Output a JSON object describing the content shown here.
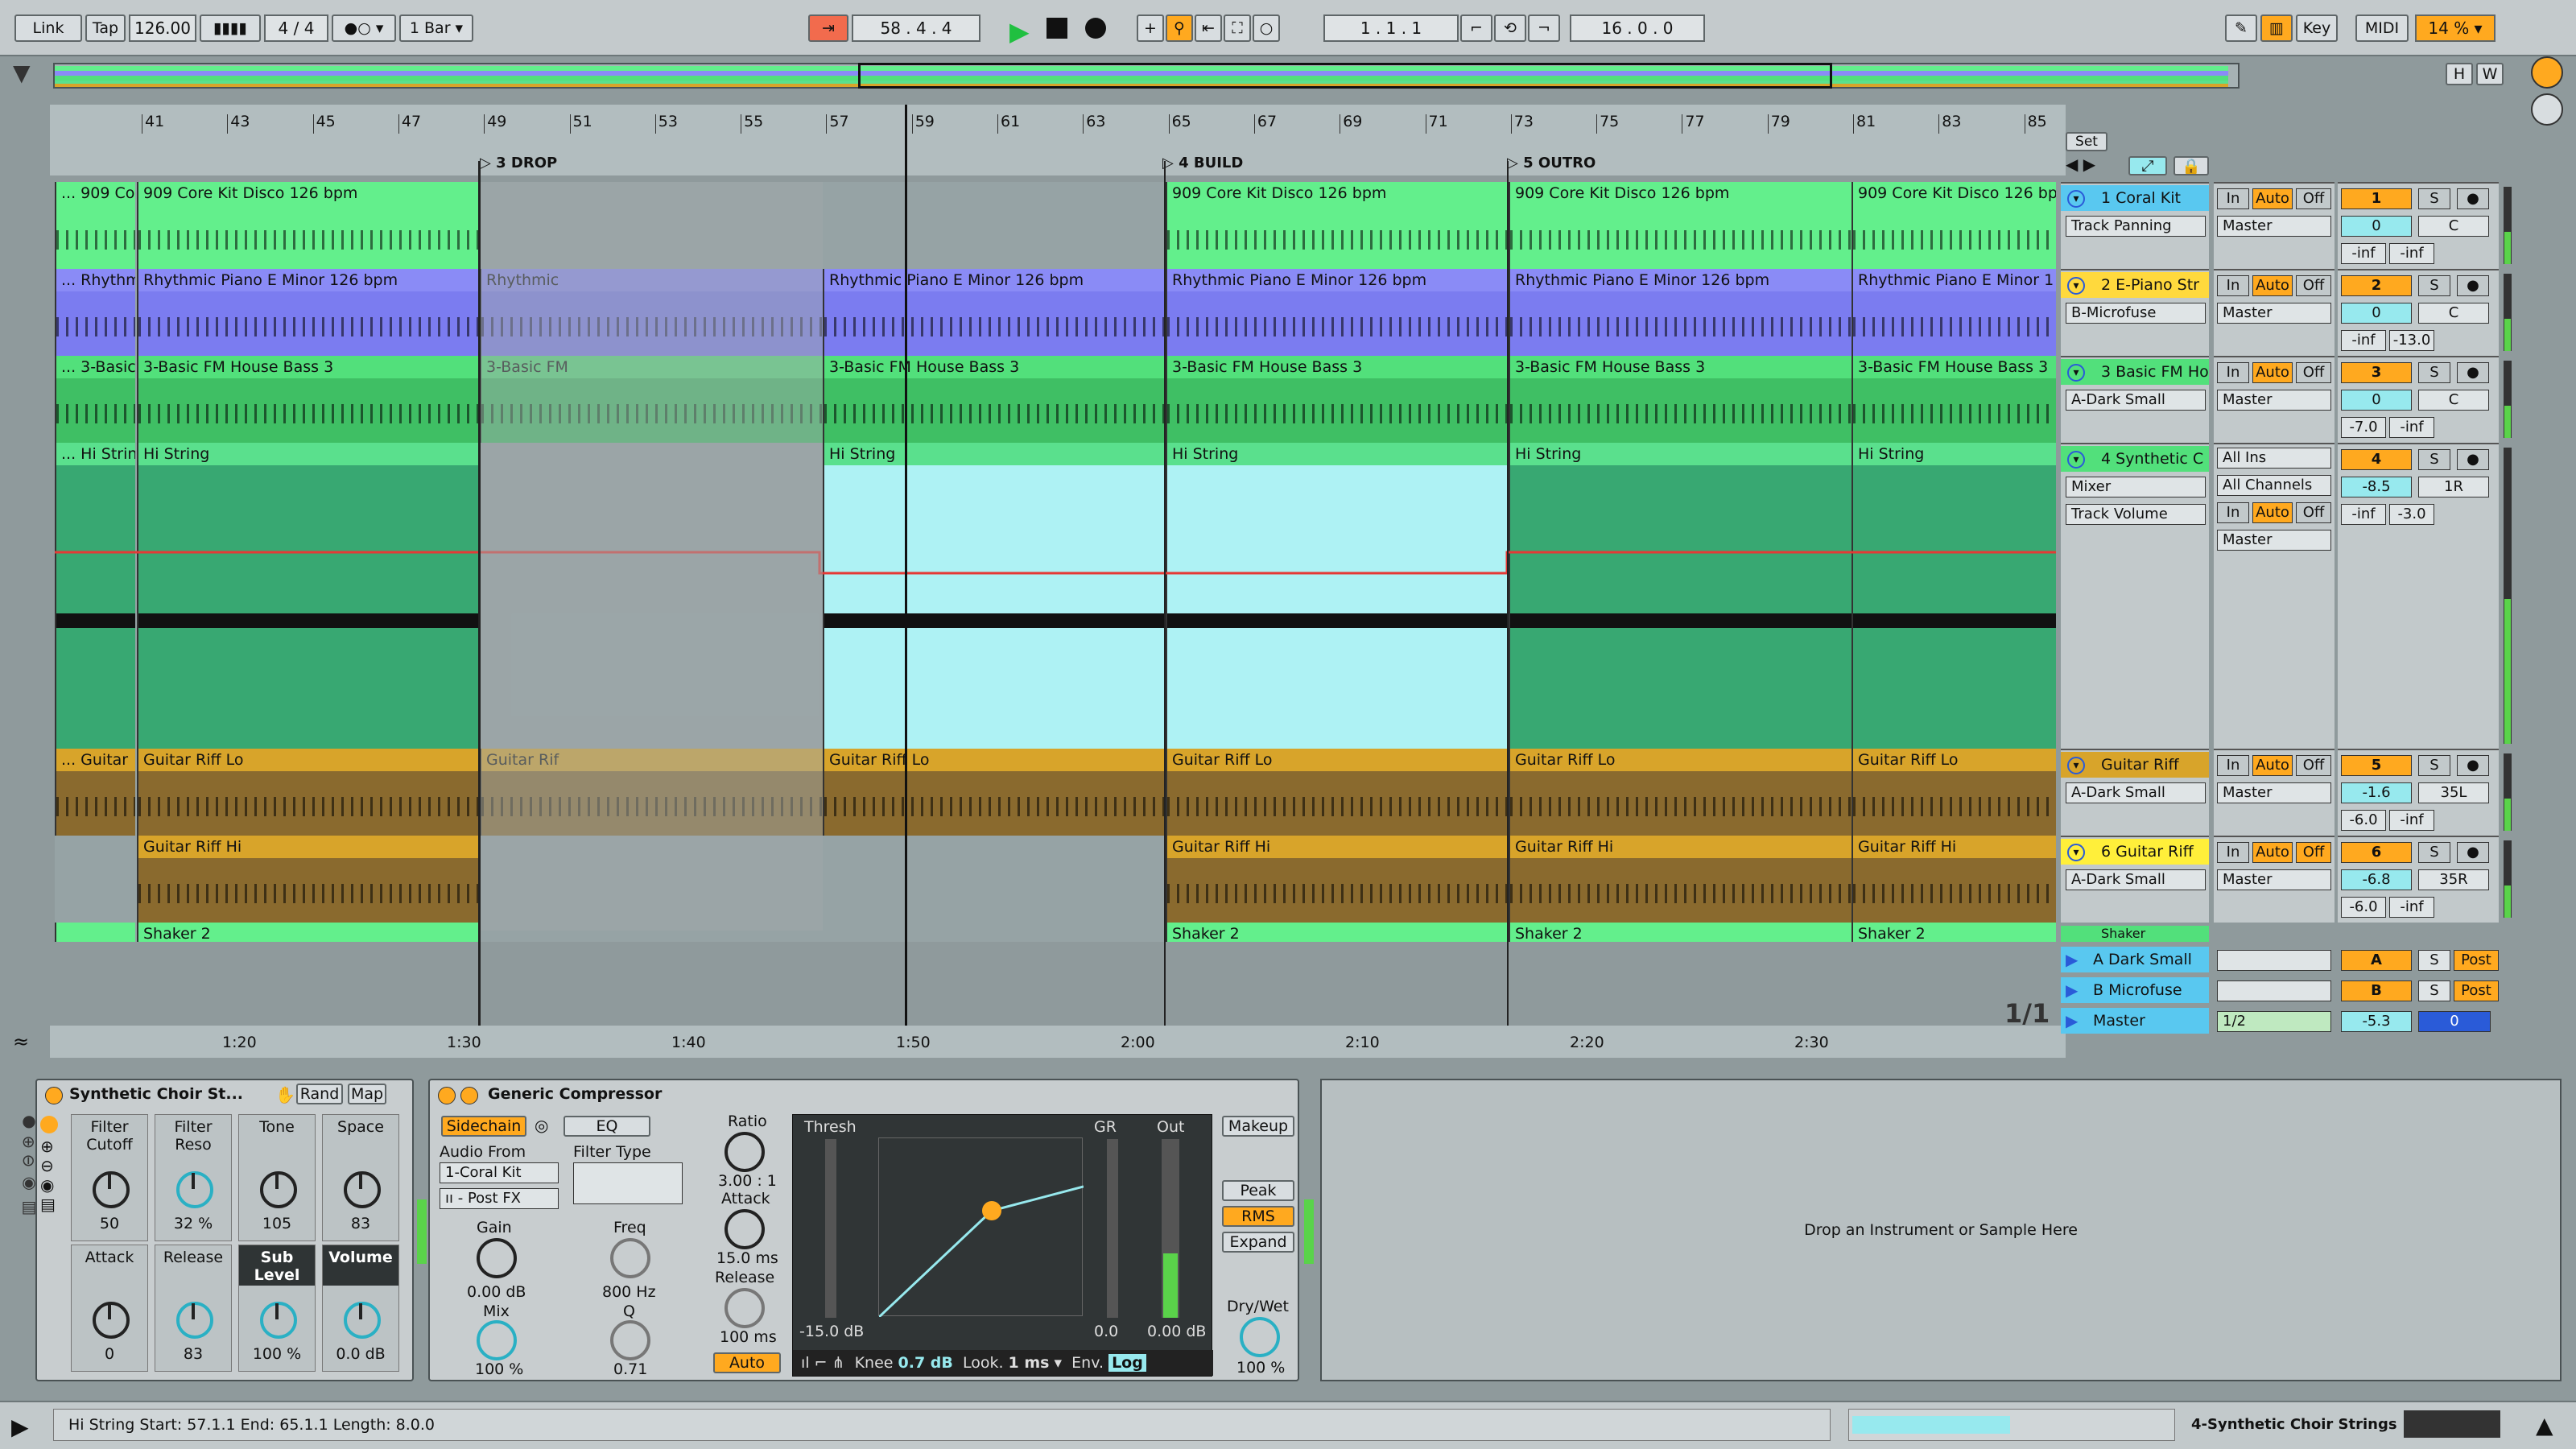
{
  "transport": {
    "link": "Link",
    "tap": "Tap",
    "tempo": "126.00",
    "time_sig": "4 / 4",
    "quantize": "1 Bar",
    "position": "58 .  4 .  4",
    "loop_start": "1 .  1 .  1",
    "loop_length": "16 .  0 .  0",
    "key": "Key",
    "midi": "MIDI",
    "cpu": "14 %",
    "h": "H",
    "w": "W"
  },
  "ruler": {
    "bars": [
      "41",
      "43",
      "45",
      "47",
      "49",
      "51",
      "53",
      "55",
      "57",
      "59",
      "61",
      "63",
      "65",
      "67",
      "69",
      "71",
      "73",
      "75",
      "77",
      "79",
      "81",
      "83",
      "85"
    ],
    "locators": [
      "3 DROP",
      "4 BUILD",
      "5 OUTRO"
    ],
    "set": "Set",
    "times": [
      "1:20",
      "1:30",
      "1:40",
      "1:50",
      "2:00",
      "2:10",
      "2:20",
      "2:30"
    ],
    "page": "1/1"
  },
  "tracks": [
    {
      "name": "1 Coral Kit",
      "clip_a": "... 909 Co",
      "clip": "909 Core Kit Disco 126 bpm",
      "dev": "Track Panning",
      "route": "Master",
      "num": "1",
      "vol": "0",
      "pan": "C",
      "m1": "-inf",
      "m2": "-inf",
      "in": "In",
      "auto": "Auto",
      "off": "Off",
      "s": "S"
    },
    {
      "name": "2 E-Piano Str",
      "clip_a": "... Rhythm",
      "clip": "Rhythmic Piano E Minor 126 bpm",
      "clip_b": "Rhythmic",
      "clip_c": "Rhythmic Piano E Minor 1",
      "dev": "B-Microfuse",
      "route": "Master",
      "num": "2",
      "vol": "0",
      "pan": "C",
      "m1": "-inf",
      "m2": "-13.0",
      "in": "In",
      "auto": "Auto",
      "off": "Off",
      "s": "S"
    },
    {
      "name": "3 Basic FM Ho",
      "clip_a": "... 3-Basic",
      "clip": "3-Basic FM House Bass 3",
      "clip_b": "3-Basic FM",
      "dev": "A-Dark Small",
      "route": "Master",
      "num": "3",
      "vol": "0",
      "pan": "C",
      "m1": "-7.0",
      "m2": "-inf",
      "in": "In",
      "auto": "Auto",
      "off": "Off",
      "s": "S"
    },
    {
      "name": "4 Synthetic C",
      "clip_a": "... Hi Strin",
      "clip": "Hi String",
      "dev": "Mixer",
      "dev2": "Track Volume",
      "route_in": "All Ins",
      "chan": "All Channels",
      "route": "Master",
      "num": "4",
      "vol": "-8.5",
      "pan": "1R",
      "m1": "-inf",
      "m2": "-3.0",
      "in": "In",
      "auto": "Auto",
      "off": "Off",
      "s": "S"
    },
    {
      "name": "Guitar Riff",
      "clip_a": "... Guitar",
      "clip": "Guitar Riff Lo",
      "clip_b": "Guitar Rif",
      "dev": "A-Dark Small",
      "route": "Master",
      "num": "5",
      "vol": "-1.6",
      "pan": "35L",
      "m1": "-6.0",
      "m2": "-inf",
      "in": "In",
      "auto": "Auto",
      "off": "Off",
      "s": "S"
    },
    {
      "name": "6 Guitar Riff",
      "clip": "Guitar Riff Hi",
      "dev": "A-Dark Small",
      "route": "Master",
      "num": "6",
      "vol": "-6.8",
      "pan": "35R",
      "m1": "-6.0",
      "m2": "-inf",
      "in": "In",
      "auto": "Auto",
      "off": "Off",
      "s": "S"
    },
    {
      "name": "Shaker",
      "clip": "Shaker 2"
    }
  ],
  "returns": [
    {
      "name": "A Dark Small",
      "letter": "A",
      "s": "S",
      "post": "Post"
    },
    {
      "name": "B Microfuse",
      "letter": "B",
      "s": "S",
      "post": "Post"
    }
  ],
  "master": {
    "name": "Master",
    "cue": "1/2",
    "vol": "-5.3",
    "pan": "0"
  },
  "rack": {
    "title": "Synthetic Choir St...",
    "rand": "Rand",
    "map": "Map",
    "macros": [
      {
        "label": "Filter Cutoff",
        "value": "50"
      },
      {
        "label": "Filter Reso",
        "value": "32 %"
      },
      {
        "label": "Tone",
        "value": "105"
      },
      {
        "label": "Space",
        "value": "83"
      },
      {
        "label": "Attack",
        "value": "0"
      },
      {
        "label": "Release",
        "value": "83"
      },
      {
        "label": "Sub Level",
        "value": "100 %"
      },
      {
        "label": "Volume",
        "value": "0.0 dB"
      }
    ]
  },
  "comp": {
    "title": "Generic Compressor",
    "sidechain": "Sidechain",
    "eq": "EQ",
    "audio_from": "Audio From",
    "src": "1-Coral Kit",
    "tap": "ıı - Post FX",
    "filter_type": "Filter Type",
    "gain": "Gain",
    "gain_v": "0.00 dB",
    "mix": "Mix",
    "mix_v": "100 %",
    "freq": "Freq",
    "freq_v": "800 Hz",
    "q": "Q",
    "q_v": "0.71",
    "ratio": "Ratio",
    "ratio_v": "3.00 : 1",
    "attack": "Attack",
    "attack_v": "15.0 ms",
    "release": "Release",
    "release_v": "100 ms",
    "auto": "Auto",
    "thresh": "Thresh",
    "thresh_v": "-15.0 dB",
    "gr": "GR",
    "gr_v": "0.0",
    "out": "Out",
    "out_v": "0.00 dB",
    "knee": "Knee",
    "knee_v": "0.7 dB",
    "look": "Look.",
    "look_v": "1 ms",
    "env": "Env.",
    "log": "Log",
    "makeup": "Makeup",
    "peak": "Peak",
    "rms": "RMS",
    "expand": "Expand",
    "drywet": "Dry/Wet",
    "drywet_v": "100 %"
  },
  "drop": "Drop an Instrument or Sample Here",
  "status": {
    "text": "Hi String  Start: 57.1.1  End: 65.1.1  Length: 8.0.0",
    "track": "4-Synthetic Choir Strings"
  },
  "colors": {
    "drum": "#63ef8c",
    "piano": "#8a8bf6",
    "bass": "#52e07b",
    "string": "#5ae08d",
    "guitar": "#d8a42a",
    "accent": "#ffa91f",
    "cyan": "#97e9ee"
  }
}
